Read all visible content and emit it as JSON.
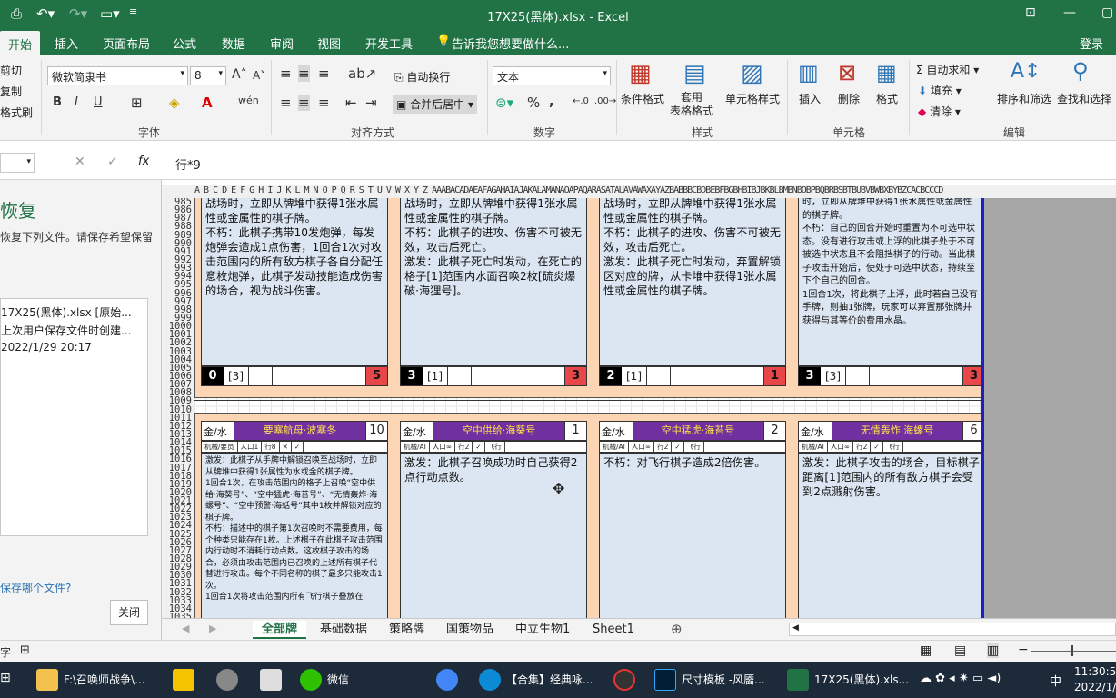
{
  "window": {
    "title": "17X25(黑体).xlsx  -  Excel",
    "login": "登录"
  },
  "ribbon_tabs": [
    "开始",
    "插入",
    "页面布局",
    "公式",
    "数据",
    "审阅",
    "视图",
    "开发工具"
  ],
  "tell_me": "告诉我您想要做什么...",
  "clipboard": {
    "cut": "剪切",
    "copy": "复制",
    "painter": "格式刷"
  },
  "font": {
    "name": "微软简隶书",
    "size": "8",
    "group": "字体",
    "bold": "B",
    "italic": "I",
    "underline": "U"
  },
  "alignment": {
    "wrap": "自动换行",
    "merge": "合并后居中",
    "group": "对齐方式"
  },
  "number": {
    "format": "文本",
    "group": "数字",
    "percent": "%",
    "comma": ","
  },
  "styles": {
    "cond": "条件格式",
    "table": "套用\n表格格式",
    "cell": "单元格样式",
    "group": "样式"
  },
  "cells": {
    "insert": "插入",
    "delete": "删除",
    "format": "格式",
    "group": "单元格"
  },
  "editing": {
    "autosum": "自动求和",
    "fill": "填充",
    "clear": "清除",
    "sort": "排序和筛选",
    "find": "查找和选择",
    "group": "编辑"
  },
  "formula_bar": {
    "fx": "fx",
    "content": "行*9"
  },
  "recovery": {
    "title": "恢复",
    "desc": "恢复下列文件。请保存希望保留",
    "file_name": "17X25(黑体).xlsx  [原始...",
    "file_desc": "上次用户保存文件时创建...",
    "file_time": "2022/1/29 20:17",
    "question": "保存哪个文件?",
    "close": "关闭"
  },
  "col_header": "A B C D E F G H I J K L M N O P Q R S T U V W X Y Z AAABACADAEAFAGAHAIAJAKALAMANAOAPAQARASATAUAVAWAXAYAZBABBBCBDBEBFBGBHBIBJBKBLBMBNBOBPBQBRBSBTBUBVBWBXBYBZCACBCCCD",
  "rows_start": 985,
  "rows_end": 1026,
  "cards_top": [
    {
      "text": "战场时，立即从牌堆中获得1张水属性或金属性的棋子牌。\n不朽：此棋子携带10发炮弹，每发炮弹会造成1点伤害，1回合1次对攻击范围内的所有敌方棋子各自分配任意枚炮弹，此棋子发动技能造成伤害的场合，视为战斗伤害。",
      "f0": "0",
      "f1": "[3]",
      "f3": "5"
    },
    {
      "text": "战场时，立即从牌堆中获得1张水属性或金属性的棋子牌。\n不朽：此棋子的进攻、伤害不可被无效，攻击后死亡。\n激发：此棋子死亡时发动，在死亡的格子[1]范围内水面召唤2枚[硫炎爆破·海狸号]。",
      "f0": "3",
      "f1": "[1]",
      "f3": "3"
    },
    {
      "text": "战场时，立即从牌堆中获得1张水属性或金属性的棋子牌。\n不朽：此棋子的进攻、伤害不可被无效，攻击后死亡。\n激发：此棋子死亡时发动，弃置解锁区对应的牌，从卡堆中获得1张水属性或金属性的棋子牌。",
      "f0": "2",
      "f1": "[1]",
      "f3": "1"
    },
    {
      "text": "时，立即从牌堆中获得1张水属性或金属性的棋子牌。\n不朽：自己的回合开始时重置为不可选中状态。没有进行攻击或上浮的此棋子处于不可被选中状态且不会阻挡棋子的行动。当此棋子攻击开始后，使处于可选中状态，持续至下个自己的回合。\n1回合1次，将此棋子上浮，此时若自己没有手牌，则抽1张牌，玩家可以弃置那张牌并获得与其等价的费用水晶。",
      "f0": "3",
      "f1": "[3]",
      "f3": "3"
    }
  ],
  "cards_bottom": [
    {
      "el": "金/水",
      "name": "要塞航母·波塞冬",
      "cost": "10",
      "sub": [
        "机械/要员",
        "人口1",
        "行8",
        "✕",
        "✓"
      ],
      "text": "激发：此棋子从手牌中解锁召唤至战场时，立即从牌堆中获得1张属性为水或金的棋子牌。\n1回合1次，在攻击范围内的格子上召唤“空中供给·海葵号”、“空中猛虎·海苔号”、“无情轰炸·海螺号”、“空中预警·海蛞号”其中1枚并解锁对应的棋子牌。\n不朽：描述中的棋子第1次召唤时不需要费用，每个种类只能存在1枚。上述棋子在此棋子攻击范围内行动时不消耗行动点数。这枚棋子攻击的场合，必须由攻击范围内已召唤的上述所有棋子代替进行攻击。每个不同名称的棋子最多只能攻击1次。\n1回合1次将攻击范围内所有飞行棋子叠放在"
    },
    {
      "el": "金/水",
      "name": "空中供给·海葵号",
      "cost": "1",
      "sub": [
        "机械/AI",
        "人口∞",
        "行2",
        "✓",
        "飞行"
      ],
      "text": "激发：此棋子召唤成功时自己获得2点行动点数。"
    },
    {
      "el": "金/水",
      "name": "空中猛虎·海苔号",
      "cost": "2",
      "sub": [
        "机械/AI",
        "人口∞",
        "行2",
        "✓",
        "飞行"
      ],
      "text": "不朽：对飞行棋子造成2倍伤害。"
    },
    {
      "el": "金/水",
      "name": "无情轰炸·海螺号",
      "cost": "6",
      "sub": [
        "机械/AI",
        "人口∞",
        "行2",
        "✓",
        "飞行"
      ],
      "text": "激发：此棋子攻击的场合，目标棋子距离[1]范围内的所有敌方棋子会受到2点溅射伤害。"
    }
  ],
  "sheet_tabs": [
    "全部牌",
    "基础数据",
    "策略牌",
    "国策物品",
    "中立生物1",
    "Sheet1"
  ],
  "status_left": "字",
  "taskbar": {
    "explorer": "F:\\召唤师战争\\...",
    "wechat": "微信",
    "edge": "【合集】经典咏...",
    "ps": "尺寸模板 -风靥...",
    "excel": "17X25(黑体).xls...",
    "ime": "中",
    "time": "11:30:50",
    "date": "2022/1/3"
  }
}
